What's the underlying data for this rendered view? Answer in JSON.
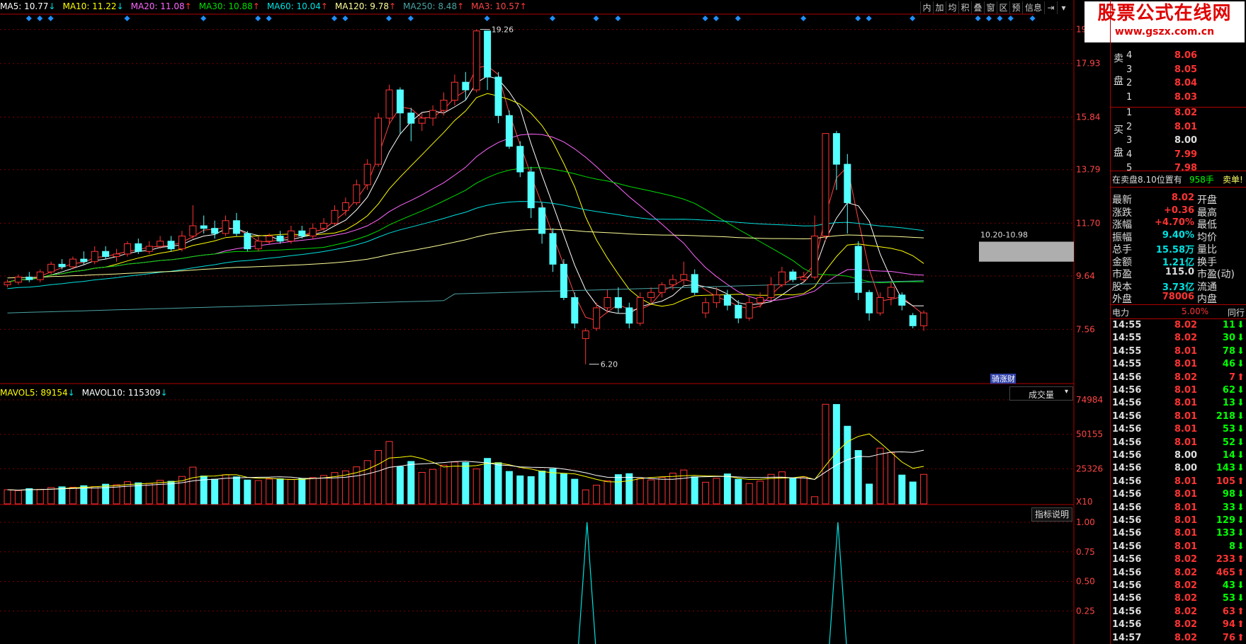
{
  "header": {
    "ma": [
      {
        "label": "MA5: 10.77",
        "arrow": "↓",
        "color": "#ffffff"
      },
      {
        "label": "MA10: 11.22",
        "arrow": "↓",
        "color": "#ffff00"
      },
      {
        "label": "MA20: 11.08",
        "arrow": "↑",
        "color": "#ff66ff"
      },
      {
        "label": "MA30: 10.88",
        "arrow": "↑",
        "color": "#00dd00"
      },
      {
        "label": "MA60: 10.04",
        "arrow": "↑",
        "color": "#00e0e0"
      },
      {
        "label": "MA120: 9.78",
        "arrow": "↑",
        "color": "#ffff99"
      },
      {
        "label": "MA250: 8.48",
        "arrow": "↑",
        "color": "#4aa3a3"
      },
      {
        "label": "MA3: 10.57",
        "arrow": "↑",
        "color": "#ff4444"
      }
    ]
  },
  "toolbar": [
    "内",
    "加",
    "均",
    "积",
    "叠",
    "窗",
    "区",
    "预",
    "信息",
    "⇥",
    "▾"
  ],
  "logo": {
    "line1": "股票公式在线网",
    "line2": "www.gszx.com.cn"
  },
  "price_axis": [
    "19.26",
    "17.93",
    "15.84",
    "13.79",
    "11.70",
    "9.64",
    "7.56"
  ],
  "annotations": {
    "high": "19.26",
    "low": "6.20",
    "zone": "10.20-10.98",
    "tag": "骑涨财"
  },
  "volume": {
    "header": [
      {
        "label": "MAVOL5: 89154",
        "arrow": "↓",
        "color": "#ffff00"
      },
      {
        "label": "MAVOL10: 115309",
        "arrow": "↓",
        "color": "#ffffff"
      }
    ],
    "dropdown": "成交量",
    "axis": [
      "74984",
      "50155",
      "25326"
    ],
    "unit": "X10"
  },
  "indicator": {
    "button": "指标说明",
    "axis": [
      "1.00",
      "0.75",
      "0.50",
      "0.25"
    ]
  },
  "order_book": {
    "sell_label": [
      "卖",
      "盘"
    ],
    "buy_label": [
      "买",
      "盘"
    ],
    "sell": [
      {
        "lvl": "4",
        "price": "8.06"
      },
      {
        "lvl": "3",
        "price": "8.05"
      },
      {
        "lvl": "2",
        "price": "8.04"
      },
      {
        "lvl": "1",
        "price": "8.03"
      }
    ],
    "buy": [
      {
        "lvl": "1",
        "price": "8.02"
      },
      {
        "lvl": "2",
        "price": "8.01"
      },
      {
        "lvl": "3",
        "price": "8.00"
      },
      {
        "lvl": "4",
        "price": "7.99"
      },
      {
        "lvl": "5",
        "price": "7.98"
      }
    ],
    "notice_left": "在卖盘8.10位置有",
    "notice_qty": "958手",
    "notice_right": "卖单!"
  },
  "quote": [
    {
      "label": "最新",
      "value": "8.02",
      "vcolor": "#ff3333",
      "r": "开盘"
    },
    {
      "label": "涨跌",
      "value": "+0.36",
      "vcolor": "#ff3333",
      "r": "最高"
    },
    {
      "label": "涨幅",
      "value": "+4.70%",
      "vcolor": "#ff3333",
      "r": "最低"
    },
    {
      "label": "振幅",
      "value": "9.40%",
      "vcolor": "#00e0e0",
      "r": "均价"
    },
    {
      "label": "总手",
      "value": "15.58万",
      "vcolor": "#00e0e0",
      "r": "量比"
    },
    {
      "label": "金额",
      "value": "1.21亿",
      "vcolor": "#00e0e0",
      "r": "换手"
    },
    {
      "label": "市盈",
      "value": "115.0",
      "vcolor": "#dddddd",
      "r": "市盈(动)"
    },
    {
      "label": "股本",
      "value": "3.73亿",
      "vcolor": "#00e0e0",
      "r": "流通"
    },
    {
      "label": "外盘",
      "value": "78006",
      "vcolor": "#ff3333",
      "r": "内盘"
    }
  ],
  "sector": {
    "name": "电力",
    "pct": "5.00%",
    "peer": "同行"
  },
  "ticks": [
    {
      "t": "14:55",
      "p": "8.02",
      "v": "11",
      "d": "down"
    },
    {
      "t": "14:55",
      "p": "8.02",
      "v": "30",
      "d": "down"
    },
    {
      "t": "14:55",
      "p": "8.01",
      "v": "78",
      "d": "down"
    },
    {
      "t": "14:55",
      "p": "8.01",
      "v": "46",
      "d": "down"
    },
    {
      "t": "14:56",
      "p": "8.02",
      "v": "7",
      "d": "up"
    },
    {
      "t": "14:56",
      "p": "8.01",
      "v": "62",
      "d": "down"
    },
    {
      "t": "14:56",
      "p": "8.01",
      "v": "13",
      "d": "down"
    },
    {
      "t": "14:56",
      "p": "8.01",
      "v": "218",
      "d": "down"
    },
    {
      "t": "14:56",
      "p": "8.01",
      "v": "53",
      "d": "down"
    },
    {
      "t": "14:56",
      "p": "8.01",
      "v": "52",
      "d": "down"
    },
    {
      "t": "14:56",
      "p": "8.00",
      "v": "14",
      "d": "down"
    },
    {
      "t": "14:56",
      "p": "8.00",
      "v": "143",
      "d": "down"
    },
    {
      "t": "14:56",
      "p": "8.01",
      "v": "105",
      "d": "up"
    },
    {
      "t": "14:56",
      "p": "8.01",
      "v": "98",
      "d": "down"
    },
    {
      "t": "14:56",
      "p": "8.01",
      "v": "33",
      "d": "down"
    },
    {
      "t": "14:56",
      "p": "8.01",
      "v": "129",
      "d": "down"
    },
    {
      "t": "14:56",
      "p": "8.01",
      "v": "133",
      "d": "down"
    },
    {
      "t": "14:56",
      "p": "8.01",
      "v": "8",
      "d": "down"
    },
    {
      "t": "14:56",
      "p": "8.02",
      "v": "233",
      "d": "up"
    },
    {
      "t": "14:56",
      "p": "8.02",
      "v": "465",
      "d": "up"
    },
    {
      "t": "14:56",
      "p": "8.02",
      "v": "43",
      "d": "down"
    },
    {
      "t": "14:56",
      "p": "8.02",
      "v": "53",
      "d": "down"
    },
    {
      "t": "14:56",
      "p": "8.02",
      "v": "63",
      "d": "up"
    },
    {
      "t": "14:56",
      "p": "8.02",
      "v": "94",
      "d": "up"
    },
    {
      "t": "14:57",
      "p": "8.02",
      "v": "76",
      "d": "up"
    }
  ],
  "chart_data": {
    "type": "candlestick",
    "price_range": [
      5.5,
      19.8
    ],
    "candles": [
      [
        9.3,
        9.4,
        9.2,
        9.5
      ],
      [
        9.4,
        9.6,
        9.3,
        9.7
      ],
      [
        9.6,
        9.5,
        9.4,
        9.8
      ],
      [
        9.5,
        9.8,
        9.4,
        9.9
      ],
      [
        9.8,
        10.1,
        9.7,
        10.2
      ],
      [
        10.1,
        10.0,
        9.9,
        10.3
      ],
      [
        10.0,
        10.3,
        9.9,
        10.4
      ],
      [
        10.3,
        10.2,
        10.1,
        10.6
      ],
      [
        10.2,
        10.6,
        10.1,
        10.8
      ],
      [
        10.6,
        10.4,
        10.3,
        10.8
      ],
      [
        10.4,
        10.5,
        10.2,
        10.7
      ],
      [
        10.5,
        10.9,
        10.4,
        11.0
      ],
      [
        10.9,
        10.6,
        10.5,
        11.1
      ],
      [
        10.6,
        10.8,
        10.5,
        11.0
      ],
      [
        10.8,
        11.0,
        10.7,
        11.2
      ],
      [
        11.0,
        10.7,
        10.6,
        11.2
      ],
      [
        10.7,
        11.2,
        10.6,
        11.4
      ],
      [
        11.2,
        11.6,
        11.1,
        12.4
      ],
      [
        11.6,
        11.5,
        11.3,
        12.0
      ],
      [
        11.5,
        11.3,
        11.1,
        11.8
      ],
      [
        11.3,
        11.8,
        11.2,
        12.0
      ],
      [
        11.8,
        11.3,
        11.2,
        12.1
      ],
      [
        11.3,
        10.7,
        10.6,
        11.4
      ],
      [
        10.7,
        11.0,
        10.6,
        11.2
      ],
      [
        11.0,
        11.2,
        10.9,
        11.3
      ],
      [
        11.2,
        11.0,
        10.9,
        11.4
      ],
      [
        11.0,
        11.4,
        10.9,
        11.6
      ],
      [
        11.4,
        11.2,
        11.1,
        11.6
      ],
      [
        11.2,
        11.5,
        11.1,
        11.7
      ],
      [
        11.5,
        11.7,
        11.4,
        11.9
      ],
      [
        11.7,
        12.2,
        11.6,
        12.4
      ],
      [
        12.2,
        12.5,
        12.0,
        12.7
      ],
      [
        12.5,
        13.2,
        12.4,
        13.4
      ],
      [
        13.2,
        14.0,
        13.0,
        14.2
      ],
      [
        14.0,
        15.8,
        13.9,
        16.0
      ],
      [
        15.8,
        16.9,
        15.6,
        17.1
      ],
      [
        16.9,
        16.0,
        15.2,
        17.0
      ],
      [
        16.0,
        15.6,
        14.9,
        16.2
      ],
      [
        15.6,
        15.8,
        15.3,
        16.0
      ],
      [
        15.8,
        16.1,
        15.5,
        16.3
      ],
      [
        16.1,
        16.5,
        15.9,
        16.8
      ],
      [
        16.5,
        17.2,
        16.3,
        17.5
      ],
      [
        17.2,
        16.9,
        16.5,
        17.6
      ],
      [
        16.9,
        19.2,
        16.8,
        19.26
      ],
      [
        19.2,
        17.4,
        16.9,
        19.2
      ],
      [
        17.4,
        15.9,
        15.6,
        17.6
      ],
      [
        15.9,
        14.7,
        14.6,
        16.1
      ],
      [
        14.7,
        13.7,
        13.5,
        14.9
      ],
      [
        13.7,
        12.3,
        11.9,
        13.9
      ],
      [
        12.3,
        11.3,
        10.9,
        12.5
      ],
      [
        11.3,
        10.1,
        9.8,
        11.5
      ],
      [
        10.1,
        8.8,
        8.7,
        10.3
      ],
      [
        8.8,
        7.8,
        7.6,
        9.0
      ],
      [
        7.2,
        7.5,
        6.2,
        7.6
      ],
      [
        7.6,
        8.4,
        7.5,
        8.6
      ],
      [
        8.4,
        8.8,
        8.2,
        9.1
      ],
      [
        8.8,
        8.4,
        8.2,
        9.2
      ],
      [
        8.4,
        7.8,
        7.6,
        8.6
      ],
      [
        7.8,
        8.8,
        7.7,
        9.0
      ],
      [
        8.8,
        9.0,
        8.6,
        9.2
      ],
      [
        9.0,
        9.3,
        8.8,
        9.4
      ],
      [
        9.3,
        9.5,
        9.1,
        9.7
      ],
      [
        9.5,
        9.7,
        9.3,
        10.2
      ],
      [
        9.7,
        9.0,
        8.9,
        9.9
      ],
      [
        8.2,
        8.6,
        8.0,
        8.8
      ],
      [
        8.6,
        8.9,
        8.4,
        9.2
      ],
      [
        8.9,
        8.5,
        8.3,
        9.1
      ],
      [
        8.5,
        8.0,
        7.8,
        8.7
      ],
      [
        8.0,
        8.6,
        7.9,
        8.8
      ],
      [
        8.6,
        8.8,
        8.4,
        9.0
      ],
      [
        8.8,
        9.3,
        8.7,
        9.6
      ],
      [
        9.3,
        9.8,
        9.2,
        10.0
      ],
      [
        9.8,
        9.5,
        9.4,
        9.9
      ],
      [
        9.5,
        9.6,
        9.4,
        9.8
      ],
      [
        9.6,
        11.2,
        9.5,
        12.0
      ],
      [
        11.2,
        15.2,
        11.0,
        15.2
      ],
      [
        15.2,
        14.0,
        13.0,
        15.3
      ],
      [
        14.0,
        12.5,
        11.3,
        14.4
      ],
      [
        10.8,
        9.0,
        8.7,
        11.0
      ],
      [
        9.0,
        8.2,
        7.9,
        9.1
      ],
      [
        8.2,
        8.8,
        8.1,
        9.0
      ],
      [
        8.8,
        9.2,
        8.5,
        9.4
      ],
      [
        8.9,
        8.5,
        8.3,
        9.0
      ],
      [
        8.1,
        7.7,
        7.6,
        8.2
      ],
      [
        7.7,
        8.2,
        7.5,
        8.3
      ]
    ],
    "volume": [
      10200,
      9600,
      11000,
      10500,
      11800,
      12300,
      12000,
      13100,
      12500,
      14200,
      13800,
      16000,
      15200,
      14700,
      17000,
      16300,
      19800,
      26500,
      20100,
      17800,
      21000,
      19500,
      17200,
      16800,
      17900,
      18100,
      17700,
      18300,
      19000,
      20500,
      22600,
      23800,
      26700,
      31200,
      38500,
      45000,
      26800,
      30600,
      22700,
      24900,
      27900,
      30200,
      29800,
      25200,
      32800,
      29700,
      23400,
      20200,
      19700,
      23700,
      25300,
      21600,
      17800,
      10100,
      13500,
      16700,
      21100,
      21800,
      18200,
      17300,
      19100,
      22200,
      24400,
      19500,
      15600,
      18400,
      21600,
      17700,
      14700,
      16400,
      21300,
      23100,
      18700,
      19400,
      5200,
      71800,
      71700,
      56000,
      38500,
      14300,
      40200,
      37000,
      20800,
      15800,
      21300
    ],
    "volume_range": [
      0,
      75000
    ],
    "indicator_signals": [
      {
        "index": 53,
        "value": 1.0
      },
      {
        "index": 76,
        "value": 1.0
      }
    ]
  }
}
